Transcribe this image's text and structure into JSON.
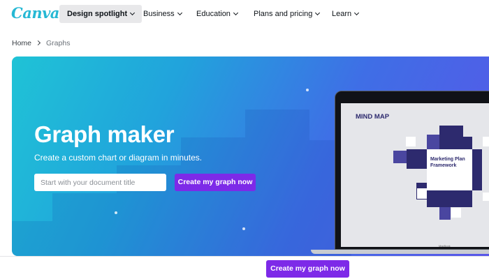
{
  "nav": {
    "logo": "Canva",
    "items": [
      {
        "label": "Design spotlight"
      },
      {
        "label": "Business"
      },
      {
        "label": "Education"
      },
      {
        "label": "Plans and pricing"
      },
      {
        "label": "Learn"
      }
    ]
  },
  "breadcrumb": {
    "home": "Home",
    "current": "Graphs"
  },
  "hero": {
    "title": "Graph maker",
    "subtitle": "Create a custom chart or diagram in minutes.",
    "input_placeholder": "Start with your document title",
    "cta": "Create my graph now",
    "gradient": [
      "#1fc3d6",
      "#21a3dc",
      "#3f6ee6",
      "#5a55e8"
    ]
  },
  "preview": {
    "heading": "MIND MAP",
    "center_text": "Marketing Plan Framework",
    "device_label": "MacBook"
  },
  "sticky": {
    "cta": "Create my graph now"
  },
  "colors": {
    "accent": "#7d2ae8",
    "logo": "#25b8d4",
    "mindmap_dark": "#2d2a6e"
  }
}
